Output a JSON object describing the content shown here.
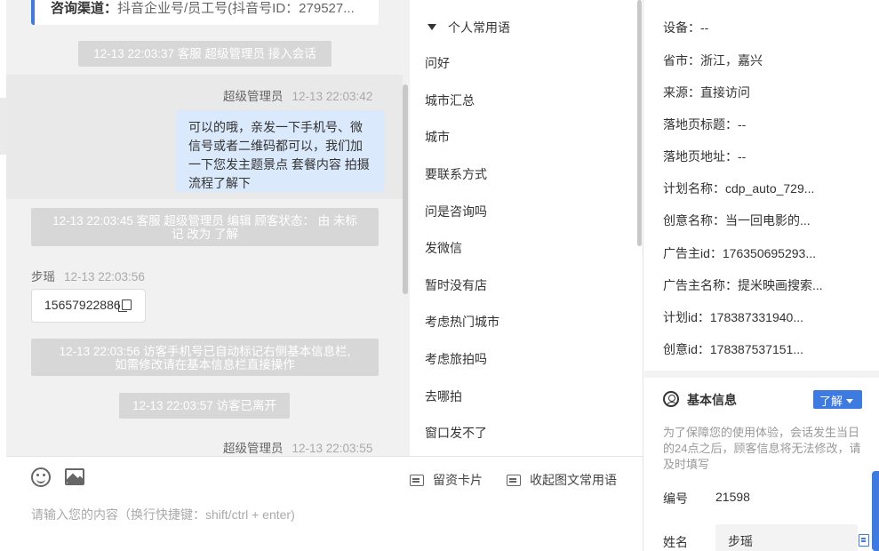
{
  "chat": {
    "channel_label": "咨询渠道：",
    "channel_value": "抖音企业号/员工号(抖音号ID：279527...",
    "system_join": "12-13 22:03:37 客服 超级管理员 接入会话",
    "msg1": {
      "sender": "超级管理员",
      "time": "12-13 22:03:42",
      "text": "可以的哦，亲发一下手机号、微信号或者二维码都可以，我们加一下您发主题景点 套餐内容 拍摄流程了解下"
    },
    "system_edit_line1": "12-13 22:03:45 客服 超级管理员 编辑 顾客状态： 由 未标",
    "system_edit_line2": "记 改为 了解",
    "msg2": {
      "sender": "步瑶",
      "time": "12-13 22:03:56",
      "phone": "15657922886"
    },
    "system_phone_line1": "12-13 22:03:56 访客手机号已自动标记右侧基本信息栏,",
    "system_phone_line2": "如需修改请在基本信息栏直接操作",
    "system_leave": "12-13 22:03:57 访客已离开",
    "msg3": {
      "sender": "超级管理员",
      "time": "12-13 22:03:55"
    }
  },
  "composer": {
    "business_card": "留资卡片",
    "collapse_phrases": "收起图文常用语",
    "placeholder": "请输入您的内容（换行快捷键：shift/ctrl + enter)"
  },
  "phrases": {
    "header": "个人常用语",
    "items": [
      "问好",
      "城市汇总",
      "城市",
      "要联系方式",
      "问是咨询吗",
      "发微信",
      "暂时没有店",
      "考虑热门城市",
      "考虑旅拍吗",
      "去哪拍",
      "窗口发不了"
    ]
  },
  "info": {
    "rows": [
      "设备：--",
      "省市：浙江，嘉兴",
      "来源：直接访问",
      "落地页标题：--",
      "落地页地址：--",
      "计划名称：cdp_auto_729...",
      "创意名称：当一回电影的...",
      "广告主id：176350695293...",
      "广告主名称：提米映画搜索...",
      "计划id：178387331940...",
      "创意id：178387537151..."
    ],
    "basic_title": "基本信息",
    "status_button": "了解",
    "notice": "为了保障您的使用体验，会话发生当日的24点之后，顾客信息将无法修改，请及时填写",
    "id_label": "编号",
    "id_value": "21598",
    "name_label": "姓名",
    "name_value": "步瑶"
  }
}
